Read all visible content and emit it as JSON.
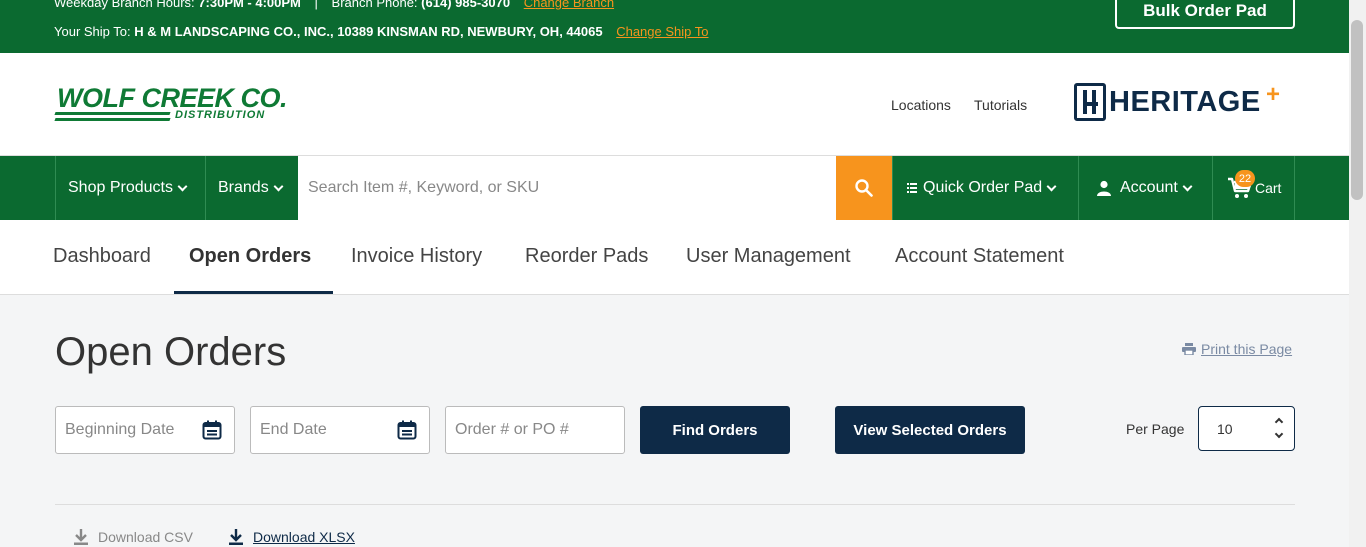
{
  "topbar": {
    "hours_label": "Weekday Branch Hours:",
    "hours_value": "7:30PM - 4:00PM",
    "separator": "|",
    "phone_label": "Branch Phone:",
    "phone_value": "(614) 985-3070",
    "change_branch": "Change Branch",
    "ship_to_label": "Your Ship To:",
    "ship_to_value": "H & M LANDSCAPING CO., INC., 10389 KINSMAN RD, NEWBURY, OH, 44065",
    "change_ship_to": "Change Ship To",
    "bulk_order_pad": "Bulk Order Pad"
  },
  "header": {
    "logo_main": "WOLF CREEK CO.",
    "logo_sub": "DISTRIBUTION",
    "links": [
      "Locations",
      "Tutorials"
    ],
    "partner_logo": "HERITAGE",
    "partner_plus": "+"
  },
  "nav": {
    "shop_products": "Shop Products",
    "brands": "Brands",
    "search_placeholder": "Search Item #, Keyword, or SKU",
    "quick_order_pad": "Quick Order Pad",
    "account": "Account",
    "cart_label": "Cart",
    "cart_count": "22"
  },
  "tabs": [
    "Dashboard",
    "Open Orders",
    "Invoice History",
    "Reorder Pads",
    "User Management",
    "Account Statement"
  ],
  "main": {
    "title": "Open Orders",
    "print_link": "Print this Page",
    "beginning_date_placeholder": "Beginning Date",
    "end_date_placeholder": "End Date",
    "order_po_placeholder": "Order # or PO #",
    "find_orders": "Find Orders",
    "view_selected_orders": "View Selected Orders",
    "per_page_label": "Per Page",
    "per_page_value": "10",
    "download_csv": "Download CSV",
    "download_xlsx": "Download XLSX"
  },
  "colors": {
    "brand_green": "#0b6a30",
    "accent_orange": "#f7941d",
    "navy": "#0e2a47"
  }
}
